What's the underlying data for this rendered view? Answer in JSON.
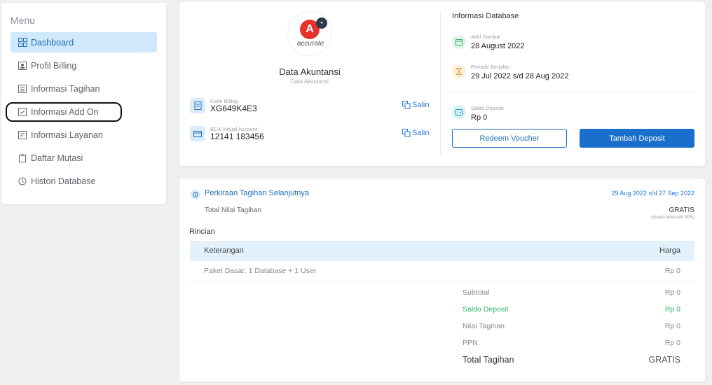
{
  "sidebar": {
    "title": "Menu",
    "items": [
      {
        "label": "Dashboard",
        "icon": "dashboard-icon"
      },
      {
        "label": "Profil Billing",
        "icon": "profile-icon"
      },
      {
        "label": "Informasi Tagihan",
        "icon": "invoice-icon"
      },
      {
        "label": "Informasi Add On",
        "icon": "addon-icon"
      },
      {
        "label": "Informasi Layanan",
        "icon": "service-icon"
      },
      {
        "label": "Daftar Mutasi",
        "icon": "clipboard-icon"
      },
      {
        "label": "Histori Database",
        "icon": "history-icon"
      }
    ]
  },
  "account": {
    "logo_text": "accurate",
    "logo_letter": "A",
    "title": "Data Akuntansi",
    "subtitle": "Data Akuntansi",
    "billing_code_label": "Kode Billing",
    "billing_code_value": "XG649K4E3",
    "va_label": "BCA Virtual Account",
    "va_value": "12141 183456",
    "copy_label": "Salin"
  },
  "database": {
    "title": "Informasi Database",
    "active_until_label": "Aktif Sampai",
    "active_until_value": "28 August 2022",
    "period_label": "Periode Berjalan",
    "period_value": "29 Jul 2022 s/d 28 Aug 2022",
    "deposit_label": "Saldo Deposit",
    "deposit_value": "Rp 0",
    "redeem_button": "Redeem Voucher",
    "add_deposit_button": "Tambah Deposit"
  },
  "estimate": {
    "title": "Perkiraan Tagihan Selanjutnya",
    "date_range": "29 Aug 2022 s/d 27 Sep 2022",
    "total_label": "Total Nilai Tagihan",
    "total_value": "GRATIS",
    "total_note": "(Sudah termasuk PPN)",
    "details_title": "Rincian",
    "col_description": "Keterangan",
    "col_price": "Harga",
    "rows": [
      {
        "description": "Paket Dasar: 1 Database + 1 User",
        "price": "Rp 0"
      }
    ],
    "summary": {
      "subtotal_label": "Subtotal",
      "subtotal_value": "Rp 0",
      "deposit_label": "Saldo Deposit",
      "deposit_value": "Rp 0",
      "bill_label": "Nilai Tagihan",
      "bill_value": "Rp 0",
      "ppn_label": "PPN",
      "ppn_value": "Rp 0",
      "total_label": "Total Tagihan",
      "total_value": "GRATIS"
    }
  },
  "colors": {
    "accent": "#1f6fb8",
    "active_bg": "#cfe8fb",
    "green": "#2fb36a",
    "logo_red": "#e5322d"
  }
}
